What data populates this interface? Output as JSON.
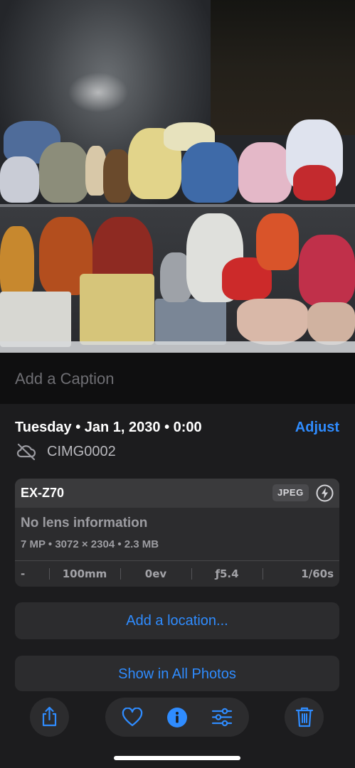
{
  "photo": {
    "description_icon": "photo-of-toy-shelf"
  },
  "caption": {
    "placeholder": "Add a Caption"
  },
  "details": {
    "date": "Tuesday • Jan 1, 2030 • 0:00",
    "adjust_label": "Adjust",
    "filename": "CIMG0002",
    "cloud_icon": "cloud-slash-icon"
  },
  "camera": {
    "model": "EX-Z70",
    "format": "JPEG",
    "flash_icon": "flash-icon",
    "lens": "No lens information",
    "specs": "7 MP • 3072 × 2304 • 2.3 MB",
    "exif": [
      "-",
      "100mm",
      "0ev",
      "ƒ5.4",
      "1/60s"
    ]
  },
  "actions": {
    "add_location": "Add a location...",
    "show_all": "Show in All Photos"
  },
  "toolbar": {
    "share_icon": "share-icon",
    "favorite_icon": "heart-icon",
    "info_icon": "info-icon",
    "edit_icon": "sliders-icon",
    "delete_icon": "trash-icon"
  },
  "colors": {
    "accent": "#2f8cff",
    "background": "#1c1c1e",
    "card": "#2c2c2e"
  }
}
